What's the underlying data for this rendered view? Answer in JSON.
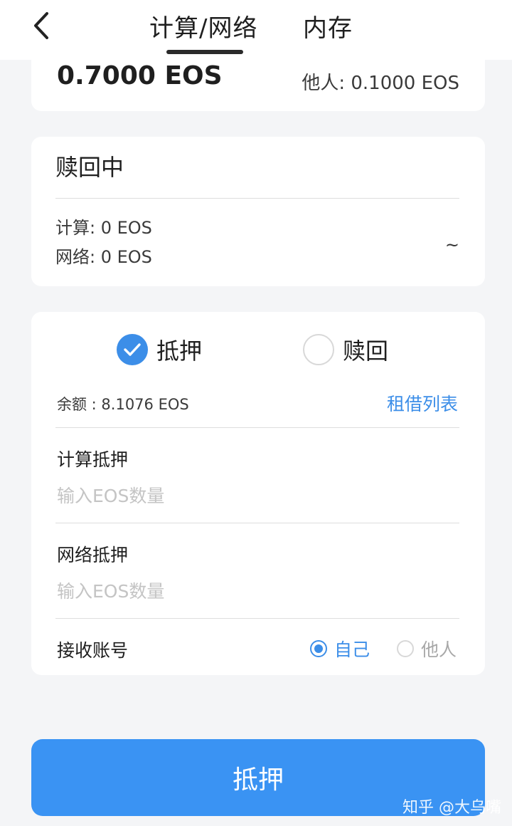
{
  "header": {
    "tabs": [
      {
        "label": "计算/网络",
        "active": true
      },
      {
        "label": "内存",
        "active": false
      }
    ]
  },
  "stake_summary": {
    "self_amount": "0.7000 EOS",
    "others_amount": "他人: 0.1000 EOS"
  },
  "redeeming": {
    "title": "赎回中",
    "compute": "计算: 0 EOS",
    "network": "网络: 0 EOS",
    "expand_glyph": "~"
  },
  "form": {
    "modes": [
      {
        "label": "抵押",
        "selected": true
      },
      {
        "label": "赎回",
        "selected": false
      }
    ],
    "balance": "余额 : 8.1076 EOS",
    "lease_list_link": "租借列表",
    "compute_stake": {
      "label": "计算抵押",
      "placeholder": "输入EOS数量",
      "value": ""
    },
    "network_stake": {
      "label": "网络抵押",
      "placeholder": "输入EOS数量",
      "value": ""
    },
    "receiver": {
      "label": "接收账号",
      "options": [
        {
          "label": "自己",
          "selected": true
        },
        {
          "label": "他人",
          "selected": false
        }
      ]
    }
  },
  "submit_label": "抵押",
  "watermark": "知乎 @大乌嘴",
  "colors": {
    "accent": "#3c8ee8",
    "button": "#3a93f3",
    "background": "#f4f5f7",
    "placeholder": "#c4c4c4"
  },
  "icons": {
    "back": "chevron-left-icon",
    "checked": "check-circle-icon"
  }
}
